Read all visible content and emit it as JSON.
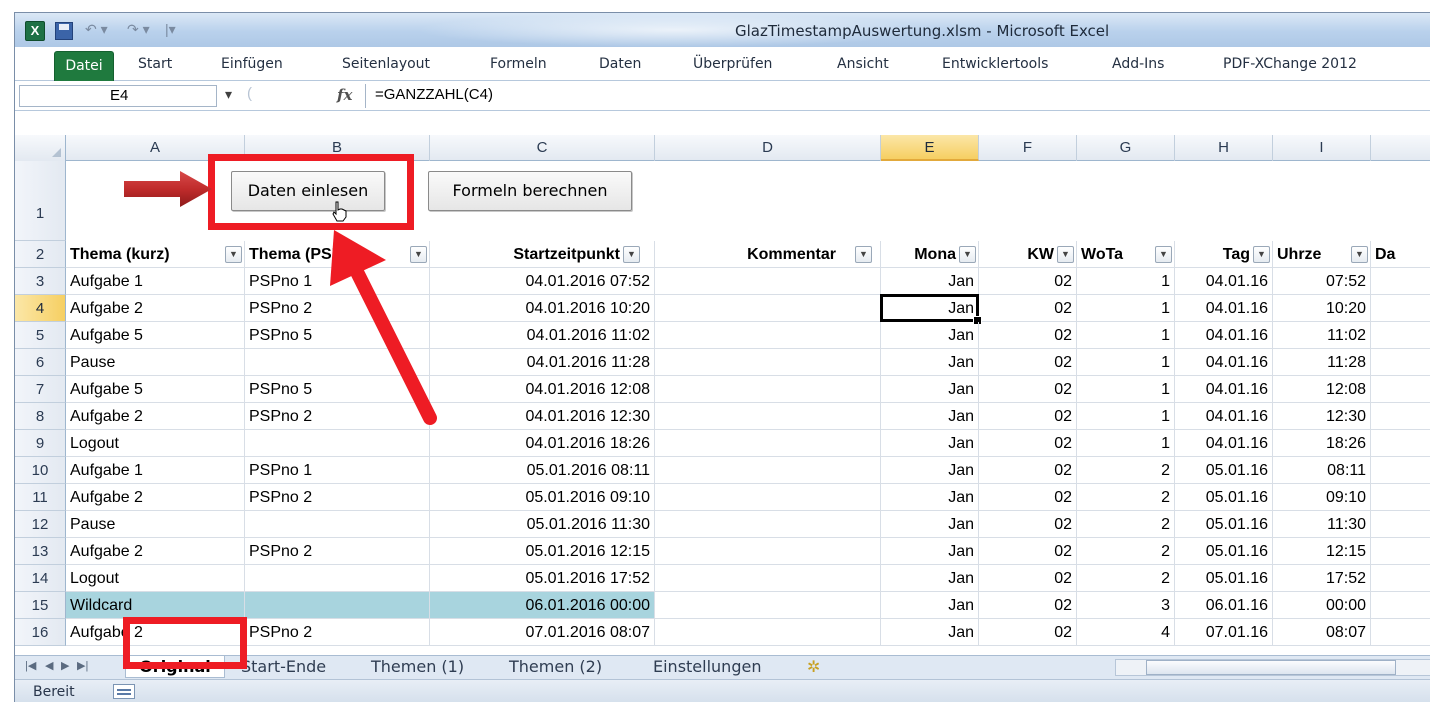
{
  "window": {
    "title": "GlazTimestampAuswertung.xlsm - Microsoft Excel",
    "app_icon_letter": "X",
    "qat_undo_glyph": "↶ ▾",
    "qat_redo_glyph": "↷ ▾",
    "qat_customize_glyph": "|▾"
  },
  "ribbon": {
    "tabs": [
      "Datei",
      "Start",
      "Einfügen",
      "Seitenlayout",
      "Formeln",
      "Daten",
      "Überprüfen",
      "Ansicht",
      "Entwicklertools",
      "Add-Ins",
      "PDF-XChange 2012"
    ],
    "active_tab": "Datei",
    "active_tab_color": "#1f7a3e"
  },
  "formula_bar": {
    "name_box": "E4",
    "formula": "=GANZZAHL(C4)",
    "fx_label": "fx"
  },
  "columns": [
    "A",
    "B",
    "C",
    "D",
    "E",
    "F",
    "G",
    "H",
    "I"
  ],
  "selected_column": "E",
  "buttons": {
    "daten_einlesen": "Daten einlesen",
    "formeln_berechnen": "Formeln berechnen"
  },
  "header_row": {
    "row_number": "2",
    "cells": [
      "Thema (kurz)",
      "Thema (PSP)",
      "Startzeitpunkt",
      "Kommentar",
      "Mona",
      "KW",
      "WoTa",
      "Tag",
      "Uhrze",
      "Da"
    ]
  },
  "rows": [
    {
      "n": "3",
      "a": "Aufgabe 1",
      "b": "PSPno 1",
      "c": "04.01.2016 07:52",
      "e": "Jan",
      "f": "02",
      "g": "1",
      "h": "04.01.16",
      "i": "07:52"
    },
    {
      "n": "4",
      "a": "Aufgabe 2",
      "b": "PSPno 2",
      "c": "04.01.2016 10:20",
      "e": "Jan",
      "f": "02",
      "g": "1",
      "h": "04.01.16",
      "i": "10:20"
    },
    {
      "n": "5",
      "a": "Aufgabe 5",
      "b": "PSPno 5",
      "c": "04.01.2016 11:02",
      "e": "Jan",
      "f": "02",
      "g": "1",
      "h": "04.01.16",
      "i": "11:02"
    },
    {
      "n": "6",
      "a": "Pause",
      "b": "",
      "c": "04.01.2016 11:28",
      "e": "Jan",
      "f": "02",
      "g": "1",
      "h": "04.01.16",
      "i": "11:28"
    },
    {
      "n": "7",
      "a": "Aufgabe 5",
      "b": "PSPno 5",
      "c": "04.01.2016 12:08",
      "e": "Jan",
      "f": "02",
      "g": "1",
      "h": "04.01.16",
      "i": "12:08"
    },
    {
      "n": "8",
      "a": "Aufgabe 2",
      "b": "PSPno 2",
      "c": "04.01.2016 12:30",
      "e": "Jan",
      "f": "02",
      "g": "1",
      "h": "04.01.16",
      "i": "12:30"
    },
    {
      "n": "9",
      "a": "Logout",
      "b": "",
      "c": "04.01.2016 18:26",
      "e": "Jan",
      "f": "02",
      "g": "1",
      "h": "04.01.16",
      "i": "18:26"
    },
    {
      "n": "10",
      "a": "Aufgabe 1",
      "b": "PSPno 1",
      "c": "05.01.2016 08:11",
      "e": "Jan",
      "f": "02",
      "g": "2",
      "h": "05.01.16",
      "i": "08:11"
    },
    {
      "n": "11",
      "a": "Aufgabe 2",
      "b": "PSPno 2",
      "c": "05.01.2016 09:10",
      "e": "Jan",
      "f": "02",
      "g": "2",
      "h": "05.01.16",
      "i": "09:10"
    },
    {
      "n": "12",
      "a": "Pause",
      "b": "",
      "c": "05.01.2016 11:30",
      "e": "Jan",
      "f": "02",
      "g": "2",
      "h": "05.01.16",
      "i": "11:30"
    },
    {
      "n": "13",
      "a": "Aufgabe 2",
      "b": "PSPno 2",
      "c": "05.01.2016 12:15",
      "e": "Jan",
      "f": "02",
      "g": "2",
      "h": "05.01.16",
      "i": "12:15"
    },
    {
      "n": "14",
      "a": "Logout",
      "b": "",
      "c": "05.01.2016 17:52",
      "e": "Jan",
      "f": "02",
      "g": "2",
      "h": "05.01.16",
      "i": "17:52"
    },
    {
      "n": "15",
      "a": "Wildcard",
      "b": "",
      "c": "06.01.2016 00:00",
      "e": "Jan",
      "f": "02",
      "g": "3",
      "h": "06.01.16",
      "i": "00:00"
    },
    {
      "n": "16",
      "a": "Aufgabe 2",
      "b": "PSPno 2",
      "c": "07.01.2016 08:07",
      "e": "Jan",
      "f": "02",
      "g": "4",
      "h": "07.01.16",
      "i": "08:07"
    }
  ],
  "selected_row": "4",
  "highlight_row": "15",
  "highlight_color": "#a8d4de",
  "sheet_tabs": [
    "Original",
    "Start-Ende",
    "Themen (1)",
    "Themen (2)",
    "Einstellungen"
  ],
  "active_sheet": "Original",
  "status": {
    "text": "Bereit"
  },
  "annotation_color": "#ee1c24",
  "icons": {
    "filter": "dropdown-triangle",
    "new_sheet": "new-sheet-icon",
    "hand_cursor": "hand-cursor-icon"
  }
}
